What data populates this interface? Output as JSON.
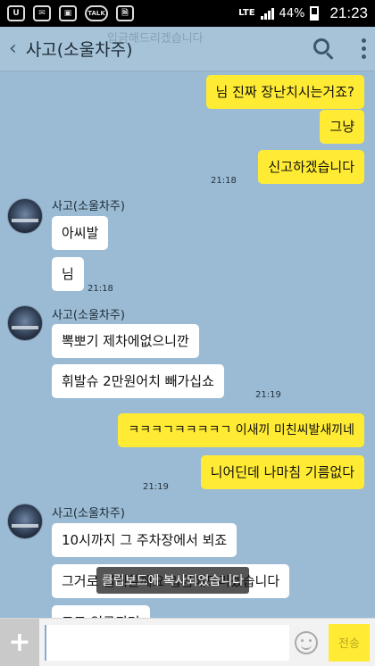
{
  "status_bar": {
    "icons": [
      "U",
      "✉",
      "▣",
      "TALK",
      "🗎"
    ],
    "network": "LTE",
    "battery": "44%",
    "time": "21:23"
  },
  "header": {
    "back_glyph": "‹",
    "title": "사고(소울차주)",
    "ghost_text": "입금해드리겠습니다"
  },
  "messages": [
    {
      "text": "님 진짜 장난치시는거죠?"
    },
    {
      "text": "그냥"
    },
    {
      "text": "신고하겠습니다"
    },
    {
      "time": "21:18"
    },
    {
      "sender": "사고(소울차주)"
    },
    {
      "text": "아씨발"
    },
    {
      "text": "님"
    },
    {
      "time": "21:18"
    },
    {
      "sender": "사고(소울차주)"
    },
    {
      "text": "뽁뽀기 제차에없으니깐"
    },
    {
      "text": "휘발슈 2만원어치 빼가십쇼"
    },
    {
      "time": "21:19"
    },
    {
      "text": "ㅋㅋㅋㄱㅋㅋㅋㅋㄱ 이새끼 미친씨발새끼네"
    },
    {
      "text": "니어딘데 나마침 기름없다"
    },
    {
      "time": "21:19"
    },
    {
      "sender": "사고(소울차주)"
    },
    {
      "text": "10시까지 그 주차장에서 뵈죠"
    },
    {
      "text": "그거로 결제할께요 입금해드리겠습니다"
    },
    {
      "text": "그그 입금되면"
    }
  ],
  "toast": "클립보드에 복사되었습니다",
  "input": {
    "plus": "+",
    "value": "",
    "send_label": "전송"
  }
}
